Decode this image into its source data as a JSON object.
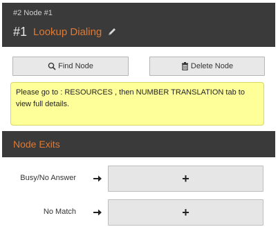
{
  "header": {
    "breadcrumb": "#2 Node #1",
    "node_number": "#1",
    "node_name": "Lookup Dialing",
    "edit_icon": "pencil-icon"
  },
  "actions": {
    "find_label": "Find Node",
    "find_icon": "search-icon",
    "delete_label": "Delete Node",
    "delete_icon": "trash-icon"
  },
  "notice": {
    "text": "Please go to : RESOURCES , then NUMBER TRANSLATION tab to view full details."
  },
  "exits": {
    "title": "Node Exits",
    "items": [
      {
        "label": "Busy/No Answer",
        "action": "+"
      },
      {
        "label": "No Match",
        "action": "+"
      }
    ]
  },
  "colors": {
    "header_bg": "#3a3a3a",
    "accent": "#e07a33",
    "notice_bg": "#ffff99"
  }
}
